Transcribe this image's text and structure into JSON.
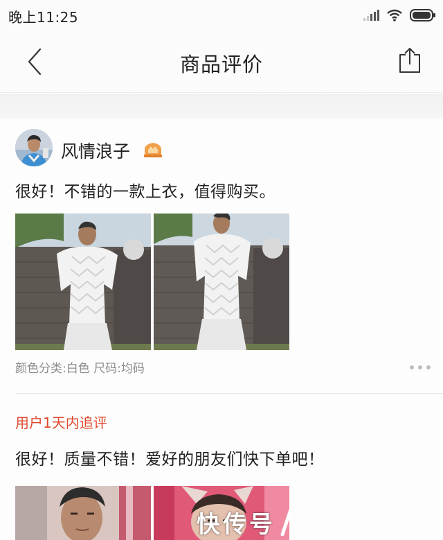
{
  "status_bar": {
    "time": "晚上11:25",
    "icons": [
      "signal-icon",
      "wifi-icon",
      "battery-icon"
    ]
  },
  "nav": {
    "title": "商品评价",
    "back_icon": "chevron-left-icon",
    "share_icon": "share-icon"
  },
  "review": {
    "username": "风情浪子",
    "badge_icon": "vip-crown-icon",
    "text": "很好！不错的一款上衣，值得购买。",
    "photo_count": 2,
    "sku": "颜色分类:白色 尺码:均码",
    "more_icon": "more-dots-icon",
    "followup_label": "用户1天内追评",
    "followup_text": "很好！质量不错！爱好的朋友们快下单吧！",
    "followup_photo_count": 2
  },
  "watermark": {
    "text": "快传号"
  },
  "colors": {
    "accent": "#e04a2f",
    "badge": "#f0a04a",
    "text_primary": "#222222",
    "text_secondary": "#8c8c8c",
    "background_band": "#f3f3f3"
  }
}
